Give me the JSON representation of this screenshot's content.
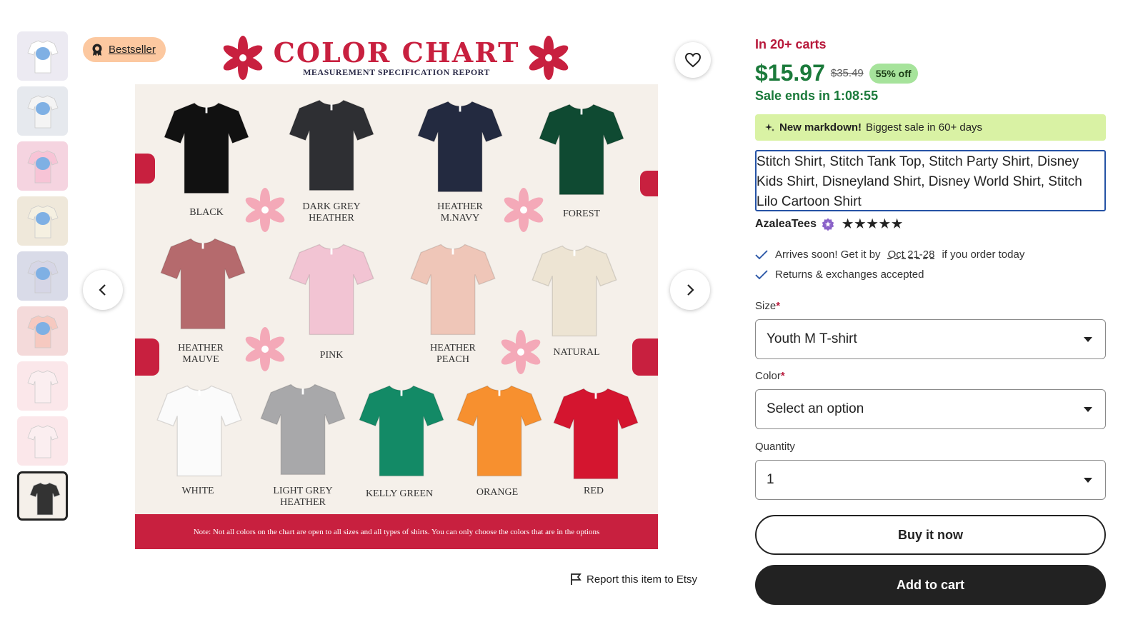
{
  "gallery": {
    "thumbnails": [
      {
        "bg": "#eceaf2",
        "tee": "#ffffff"
      },
      {
        "bg": "#e6e9ee",
        "tee": "#f4f4f4"
      },
      {
        "bg": "#f5d4e0",
        "tee": "#f7c4d6"
      },
      {
        "bg": "#efe8da",
        "tee": "#f5f0e1"
      },
      {
        "bg": "#d9dbe8",
        "tee": "#d6d6e6"
      },
      {
        "bg": "#f4dada",
        "tee": "#f6c9c0"
      },
      {
        "bg": "#fbe7ea",
        "tee": "#fbeef0"
      },
      {
        "bg": "#fbe7ea",
        "tee": "#fbeef0"
      },
      {
        "bg": "#f5f0ea",
        "tee": "#333333"
      }
    ],
    "active_index": 8,
    "badge": "Bestseller",
    "favorite_icon": "heart-icon",
    "prev_icon": "chevron-left-icon",
    "next_icon": "chevron-right-icon",
    "report_label": "Report this item to Etsy"
  },
  "color_chart": {
    "title": "COLOR CHART",
    "subtitle": "MEASUREMENT SPECIFICATION REPORT",
    "colors": [
      {
        "name": "BLACK",
        "hex": "#111111"
      },
      {
        "name": "DARK GREY HEATHER",
        "line1": "DARK GREY",
        "line2": "HEATHER",
        "hex": "#2e2f33"
      },
      {
        "name": "HEATHER M.NAVY",
        "line1": "HEATHER",
        "line2": "M.NAVY",
        "hex": "#232a40"
      },
      {
        "name": "FOREST",
        "hex": "#0f4a32"
      },
      {
        "name": "HEATHER MAUVE",
        "line1": "HEATHER",
        "line2": "MAUVE",
        "hex": "#b56a6d"
      },
      {
        "name": "PINK",
        "hex": "#f2c4d3"
      },
      {
        "name": "HEATHER PEACH",
        "line1": "HEATHER",
        "line2": "PEACH",
        "hex": "#efc6b8"
      },
      {
        "name": "NATURAL",
        "hex": "#ede4d3"
      },
      {
        "name": "WHITE",
        "hex": "#fbfbfb"
      },
      {
        "name": "LIGHT GREY HEATHER",
        "line1": "LIGHT GREY",
        "line2": "HEATHER",
        "hex": "#a8a8aa"
      },
      {
        "name": "KELLY GREEN",
        "hex": "#138a66"
      },
      {
        "name": "ORANGE",
        "hex": "#f7902f"
      },
      {
        "name": "RED",
        "hex": "#d4152f"
      }
    ],
    "note": "Note: Not all colors on the chart are open to all sizes and all types of shirts. You can only choose the colors that are in the options"
  },
  "listing": {
    "in_carts": "In 20+ carts",
    "price": "$15.97",
    "original_price": "$35.49",
    "discount": "55% off",
    "sale_ends": "Sale ends in 1:08:55",
    "markdown_bold": "New markdown!",
    "markdown_text": "Biggest sale in 60+ days",
    "title": "Stitch Shirt, Stitch Tank Top, Stitch Party Shirt, Disney Kids Shirt, Disneyland Shirt, Disney World Shirt, Stitch Lilo Cartoon Shirt",
    "shop_name": "AzaleaTees",
    "rating": 5,
    "shipping_prefix": "Arrives soon! Get it by",
    "shipping_dates": "Oct 21-28",
    "shipping_suffix": "if you order today",
    "returns": "Returns & exchanges accepted",
    "size_label": "Size",
    "size_value": "Youth M T-shirt",
    "color_label": "Color",
    "color_value": "Select an option",
    "quantity_label": "Quantity",
    "quantity_value": "1",
    "buy_now": "Buy it now",
    "add_to_cart": "Add to cart",
    "accent_red": "#b8193b",
    "price_green": "#1b7a3b"
  }
}
